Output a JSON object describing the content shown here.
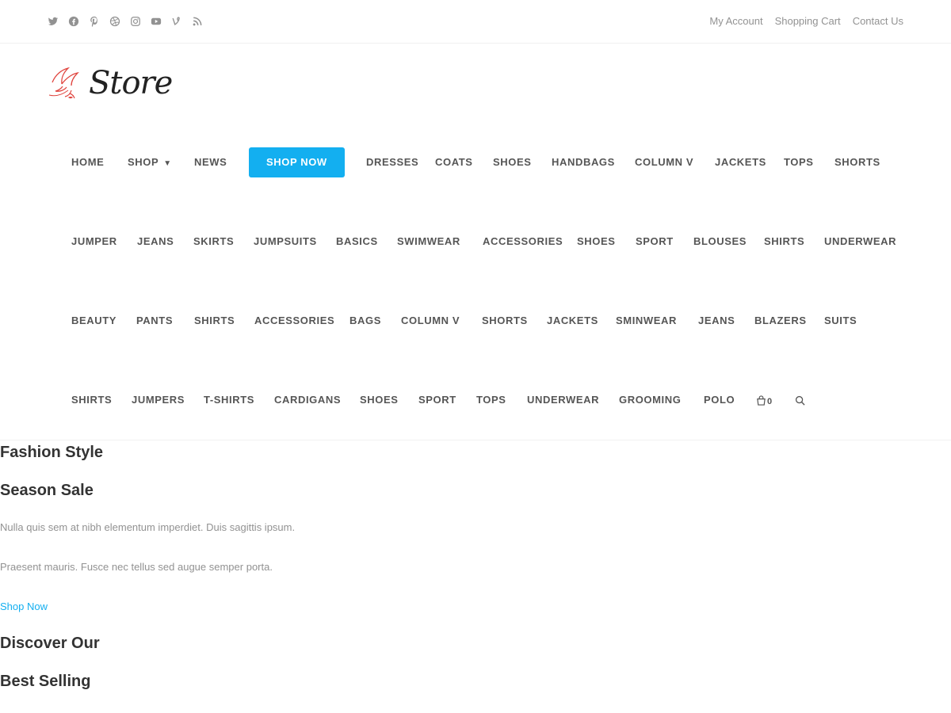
{
  "topbar": {
    "social_icons": [
      "twitter-icon",
      "facebook-icon",
      "pinterest-icon",
      "dribbble-icon",
      "instagram-icon",
      "youtube-icon",
      "vine-icon",
      "rss-icon"
    ],
    "links": [
      "My Account",
      "Shopping Cart",
      "Contact Us"
    ]
  },
  "logo": {
    "text": "Store",
    "accent_color": "#e0453f"
  },
  "nav": {
    "row1": [
      {
        "label": "HOME"
      },
      {
        "label": "SHOP"
      },
      {
        "label": "NEWS"
      },
      {
        "label": "SHOP NOW"
      },
      {
        "label": "DRESSES"
      },
      {
        "label": "COATS"
      },
      {
        "label": "SHOES"
      },
      {
        "label": "HANDBAGS"
      },
      {
        "label": "COLUMN V"
      },
      {
        "label": "JACKETS"
      },
      {
        "label": "TOPS"
      },
      {
        "label": "SHORTS"
      }
    ],
    "row2": [
      "JUMPER",
      "JEANS",
      "SKIRTS",
      "JUMPSUITS",
      "BASICS",
      "SWIMWEAR",
      "ACCESSORIES",
      "SHOES",
      "SPORT",
      "BLOUSES",
      "SHIRTS",
      "UNDERWEAR"
    ],
    "row3": [
      "BEAUTY",
      "PANTS",
      "SHIRTS",
      "ACCESSORIES",
      "BAGS",
      "COLUMN V",
      "SHORTS",
      "JACKETS",
      "SMINWEAR",
      "JEANS",
      "BLAZERS",
      "SUITS"
    ],
    "row4": [
      "SHIRTS",
      "JUMPERS",
      "T-SHIRTS",
      "CARDIGANS",
      "SHOES",
      "SPORT",
      "TOPS",
      "UNDERWEAR",
      "GROOMING",
      "POLO"
    ],
    "cart_count": "0",
    "accent_color": "#13aff0"
  },
  "content": {
    "heading1": "Fashion Style",
    "heading2": "Season Sale",
    "para1": "Nulla quis sem at nibh elementum imperdiet. Duis sagittis ipsum.",
    "para2": "Praesent mauris. Fusce nec tellus sed augue semper porta.",
    "link": "Shop Now",
    "heading3": "Discover Our",
    "heading4": "Best Selling"
  }
}
